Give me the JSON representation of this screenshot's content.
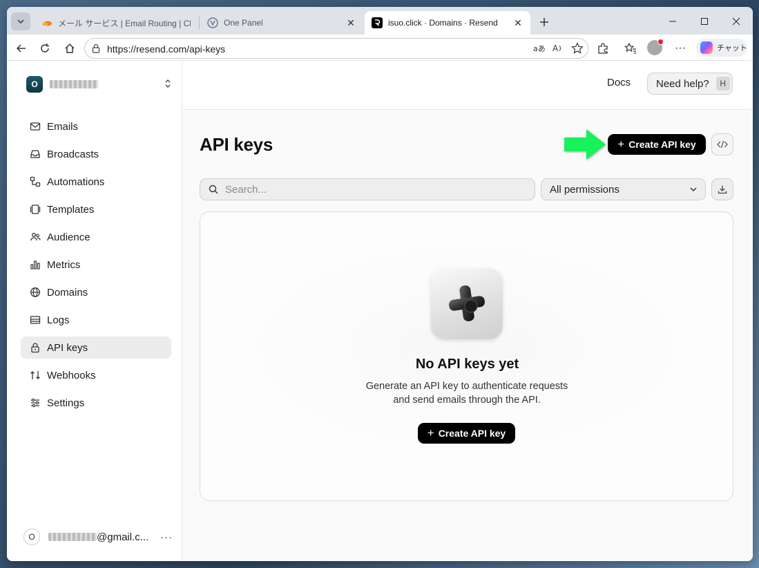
{
  "browser": {
    "tabs": [
      {
        "title": "メール サービス | Email Routing | Clou",
        "active": false
      },
      {
        "title": "One Panel",
        "active": false
      },
      {
        "title": "isuo.click · Domains · Resend",
        "active": true
      }
    ],
    "url": "https://resend.com/api-keys",
    "copilot_label": "チャット"
  },
  "sidebar": {
    "team_badge": "O",
    "items": [
      {
        "label": "Emails",
        "icon": "mail-icon"
      },
      {
        "label": "Broadcasts",
        "icon": "inbox-icon"
      },
      {
        "label": "Automations",
        "icon": "automation-icon"
      },
      {
        "label": "Templates",
        "icon": "template-icon"
      },
      {
        "label": "Audience",
        "icon": "users-icon"
      },
      {
        "label": "Metrics",
        "icon": "bar-chart-icon"
      },
      {
        "label": "Domains",
        "icon": "globe-icon"
      },
      {
        "label": "Logs",
        "icon": "logs-icon"
      },
      {
        "label": "API keys",
        "icon": "lock-icon",
        "active": true
      },
      {
        "label": "Webhooks",
        "icon": "webhook-icon"
      },
      {
        "label": "Settings",
        "icon": "settings-icon"
      }
    ],
    "user": {
      "avatar": "O",
      "email_suffix": "@gmail.c...",
      "more": "···"
    }
  },
  "header": {
    "docs_label": "Docs",
    "help_label": "Need help?",
    "help_shortcut": "H"
  },
  "main": {
    "title": "API keys",
    "create_button_label": "Create API key",
    "search_placeholder": "Search...",
    "permissions_filter": "All permissions",
    "empty": {
      "title": "No API keys yet",
      "description": "Generate an API key to authenticate requests and send emails through the API.",
      "button_label": "Create API key"
    }
  },
  "colors": {
    "accent_black": "#000000",
    "annotation_arrow": "#19f25a",
    "active_nav_bg": "#ececec"
  }
}
